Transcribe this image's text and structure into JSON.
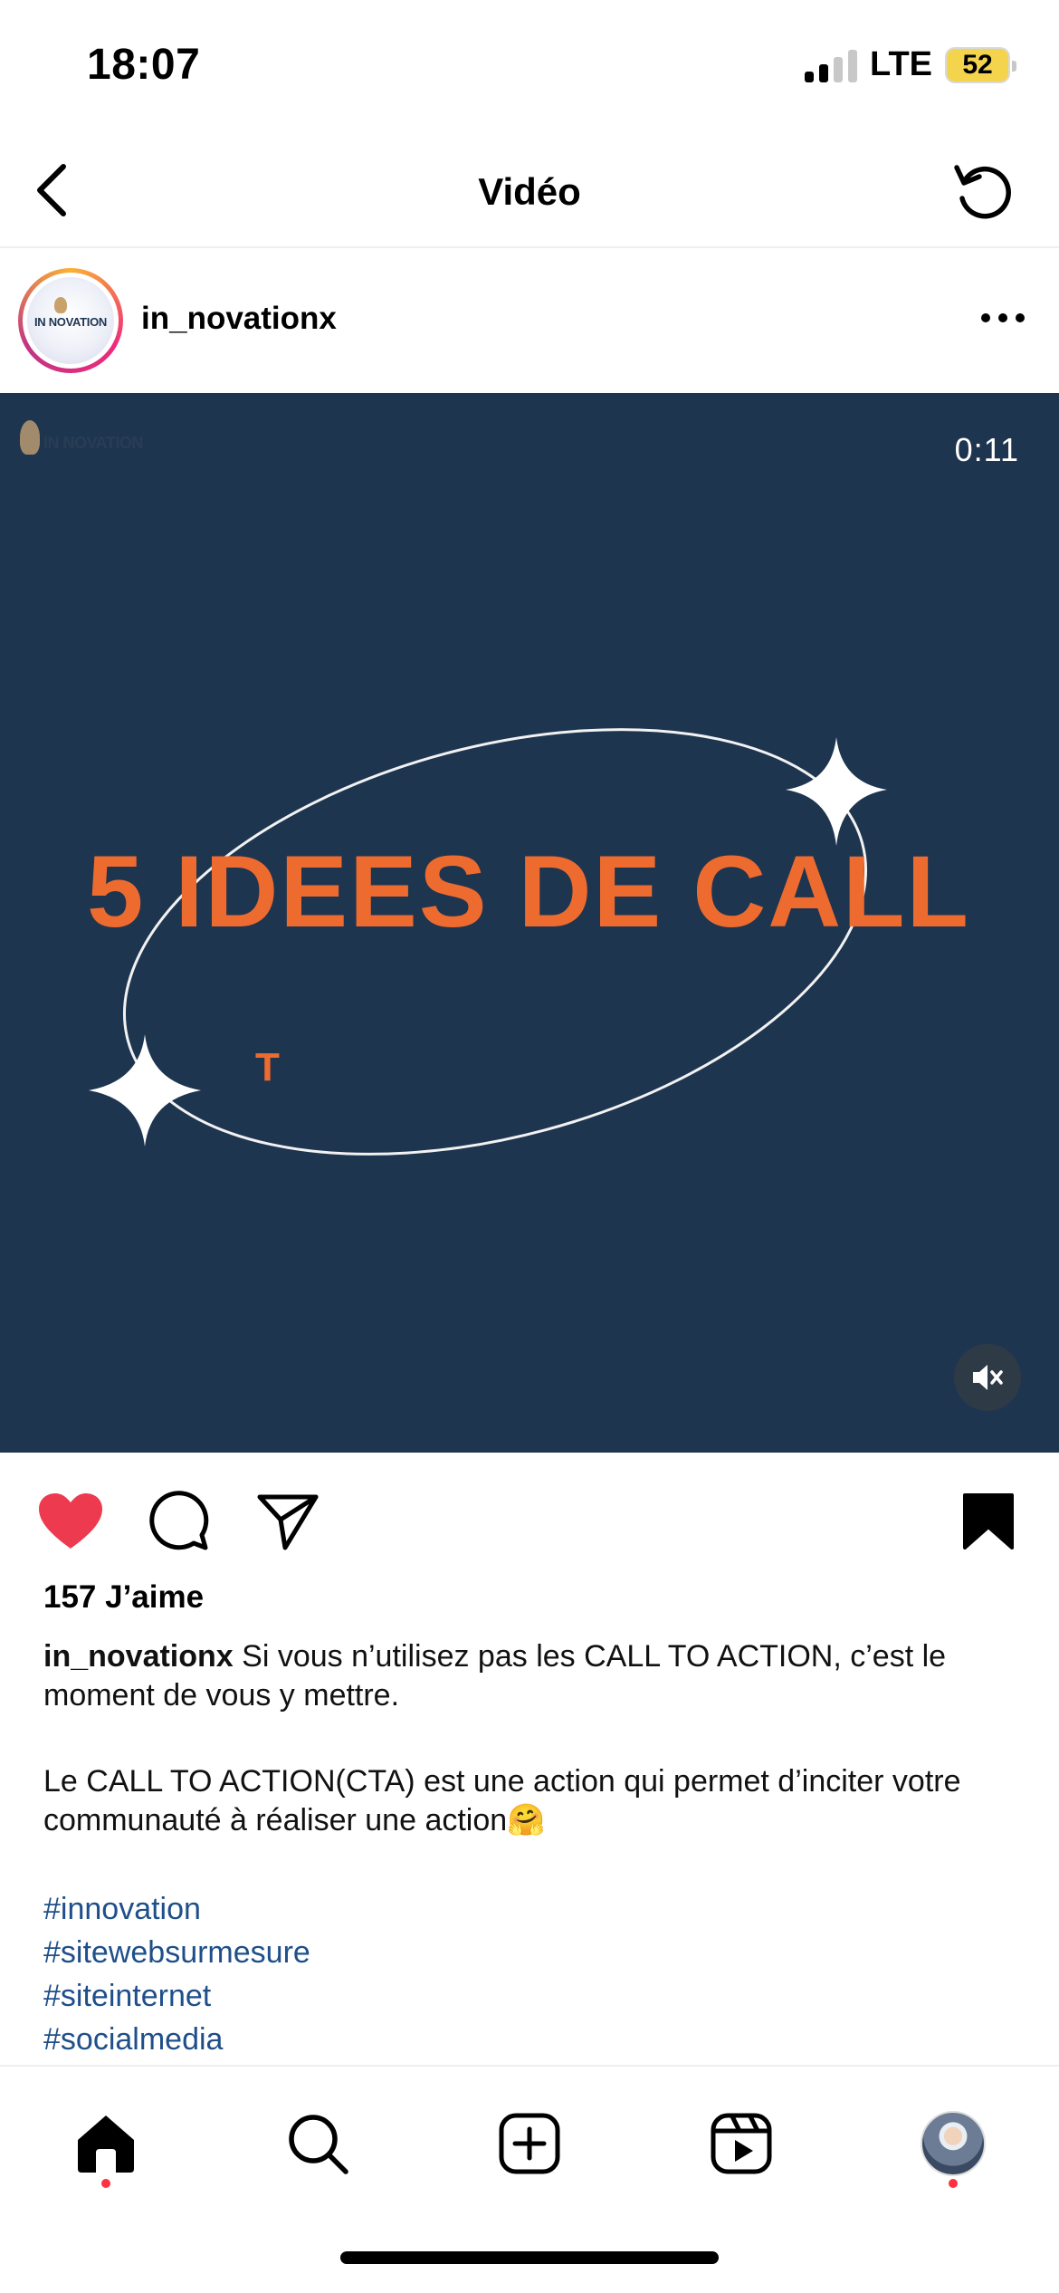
{
  "status_bar": {
    "time": "18:07",
    "network": "LTE",
    "battery": "52"
  },
  "nav": {
    "title": "Vidéo"
  },
  "post": {
    "username": "in_novationx",
    "avatar_text": "IN NOVATION",
    "video": {
      "watermark": "IN NOVATION",
      "timer": "0:11",
      "headline": "5 IDEES DE CALL",
      "subletter": "T",
      "colors": {
        "background": "#1e3550",
        "headline": "#ee6b2f"
      }
    },
    "liked": true,
    "saved": true,
    "likes": "157 J’aime",
    "caption": {
      "username": "in_novationx",
      "line1": " Si vous n’utilisez pas les CALL TO ACTION, c’est le moment de vous y mettre.",
      "line2": "Le CALL TO ACTION(CTA) est une action qui permet d’inciter votre communauté à réaliser une action🤗"
    },
    "hashtags": [
      "#innovation",
      "#sitewebsurmesure",
      "#siteinternet",
      "#socialmedia"
    ]
  },
  "icons": {
    "back": "chevron-left-icon",
    "refresh": "refresh-icon",
    "more": "more-horizontal-icon",
    "mute": "speaker-muted-icon",
    "like": "heart-filled-icon",
    "comment": "comment-icon",
    "share": "send-icon",
    "save": "bookmark-filled-icon",
    "tabs": [
      "home-icon",
      "search-icon",
      "create-icon",
      "reels-icon",
      "profile-avatar"
    ]
  },
  "colors": {
    "like": "#ed3a4f",
    "hashtag": "#1f4f8a",
    "notification_dot": "#ff3040"
  }
}
